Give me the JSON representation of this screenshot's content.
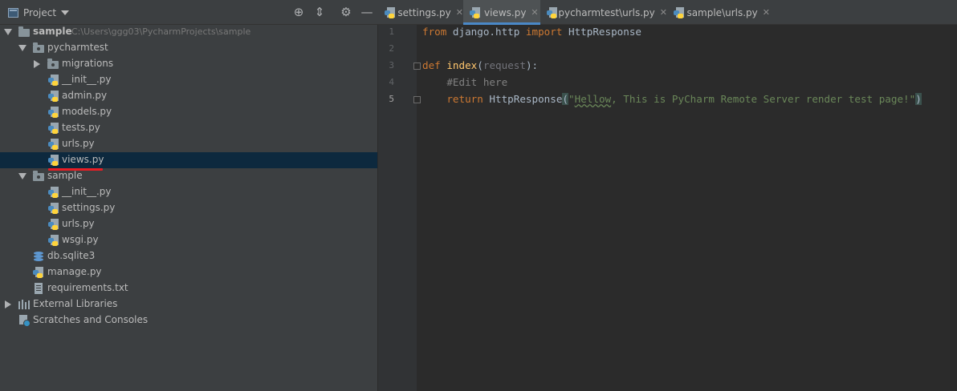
{
  "project_panel": {
    "title": "Project",
    "tools": [
      "locate-icon",
      "collapse-icon",
      "gear-icon",
      "minimize-icon"
    ]
  },
  "tree": {
    "root": {
      "label": "sample",
      "path": "C:\\Users\\ggg03\\PycharmProjects\\sample"
    },
    "items": [
      {
        "label": "pycharmtest"
      },
      {
        "label": "migrations"
      },
      {
        "label": "__init__.py"
      },
      {
        "label": "admin.py"
      },
      {
        "label": "models.py"
      },
      {
        "label": "tests.py"
      },
      {
        "label": "urls.py"
      },
      {
        "label": "views.py"
      },
      {
        "label": "sample"
      },
      {
        "label": "__init__.py"
      },
      {
        "label": "settings.py"
      },
      {
        "label": "urls.py"
      },
      {
        "label": "wsgi.py"
      },
      {
        "label": "db.sqlite3"
      },
      {
        "label": "manage.py"
      },
      {
        "label": "requirements.txt"
      },
      {
        "label": "External Libraries"
      },
      {
        "label": "Scratches and Consoles"
      }
    ],
    "selected": "views.py",
    "highlight_color": "#e81e25"
  },
  "tabs": [
    {
      "label": "settings.py",
      "active": false
    },
    {
      "label": "views.py",
      "active": true
    },
    {
      "label": "pycharmtest\\urls.py",
      "active": false
    },
    {
      "label": "sample\\urls.py",
      "active": false
    }
  ],
  "editor": {
    "line_numbers": [
      "1",
      "2",
      "3",
      "4",
      "5"
    ],
    "current_line": "5",
    "code": {
      "l1": {
        "kw1": "from",
        "mod": " django.http ",
        "kw2": "import",
        "name": " HttpResponse"
      },
      "l3": {
        "kw": "def",
        "sp": " ",
        "fn": "index",
        "open": "(",
        "param": "request",
        "close": "):"
      },
      "l4": {
        "indent": "    ",
        "comment": "#Edit here"
      },
      "l5": {
        "indent": "    ",
        "kw": "return",
        "call": " HttpResponse",
        "open": "(",
        "q": "\"",
        "typo": "Hellow",
        "rest": ", This is PyCharm Remote Server render test page!\"",
        "close": ")"
      }
    }
  }
}
